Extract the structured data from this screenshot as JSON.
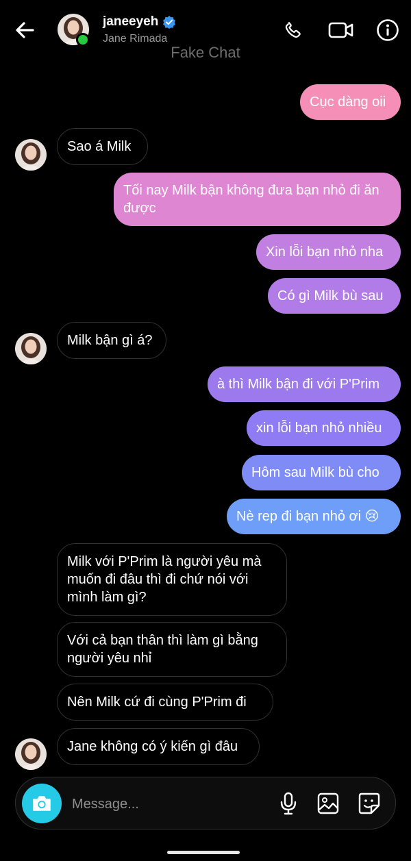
{
  "header": {
    "username": "janeeyeh",
    "full_name": "Jane Rimada",
    "watermark": "Fake Chat",
    "icons": [
      "back-arrow-icon",
      "verified-badge-icon",
      "phone-icon",
      "video-camera-icon",
      "info-icon"
    ]
  },
  "messages": [
    {
      "side": "sent",
      "text": "Cục dàng oii",
      "color": "#f58fb8"
    },
    {
      "side": "received",
      "text": "Sao á Milk"
    },
    {
      "side": "sent",
      "text": "Tối nay Milk bận không đưa bạn nhỏ đi ăn được",
      "color": "#de86d2"
    },
    {
      "side": "sent",
      "text": "Xin lỗi bạn nhỏ nha",
      "color": "#c27fe2"
    },
    {
      "side": "sent",
      "text": "Có gì Milk bù sau",
      "color": "#b27ce8"
    },
    {
      "side": "received",
      "text": "Milk bận gì á?"
    },
    {
      "side": "sent",
      "text": "à thì Milk bận đi với P'Prim",
      "color": "#9d79ee"
    },
    {
      "side": "sent",
      "text": "xin lỗi bạn nhỏ nhiều",
      "color": "#8f7cf4"
    },
    {
      "side": "sent",
      "text": "Hôm sau Milk bù cho",
      "color": "#7f8cf6"
    },
    {
      "side": "sent",
      "text": "Nè rep đi bạn nhỏ ơi 😢",
      "color": "#6e9ef8"
    },
    {
      "side": "received",
      "text": "Milk với P'Prim là người yêu mà muốn đi đâu thì đi chứ nói với mình làm gì?"
    },
    {
      "side": "received",
      "text": "Với cả bạn thân thì làm gì bằng người yêu nhỉ"
    },
    {
      "side": "received",
      "text": "Nên Milk cứ đi cùng P'Prim đi"
    },
    {
      "side": "received",
      "text": "Jane không có ý kiến gì đâu"
    }
  ],
  "composer": {
    "placeholder": "Message...",
    "icons": [
      "camera-icon",
      "microphone-icon",
      "gallery-icon",
      "sticker-icon"
    ],
    "camera_button_color": "#25cbe6"
  }
}
